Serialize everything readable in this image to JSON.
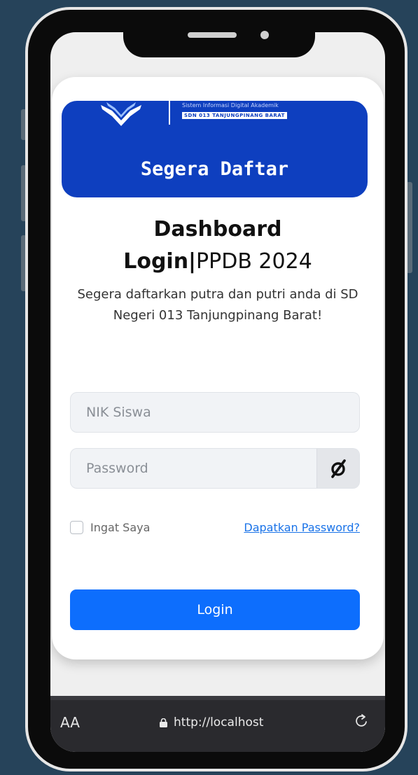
{
  "banner": {
    "brand_subtitle": "Sistem Informasi Digital Akademik",
    "brand_tag": "SDN 013 TANJUNGPINANG BARAT",
    "title": "Segera Daftar"
  },
  "login": {
    "heading_line1": "Dashboard",
    "heading_line2_bold": "Login|",
    "heading_line2_rest": "PPDB 2024",
    "description": "Segera daftarkan putra dan putri anda di SD Negeri 013 Tanjungpinang Barat!",
    "nik_placeholder": "NIK Siswa",
    "password_placeholder": "Password",
    "remember_label": "Ingat Saya",
    "forgot_link": "Dapatkan Password?",
    "login_button": "Login",
    "password_toggle_icon": "eye-slash-icon"
  },
  "browser": {
    "text_size_label": "AA",
    "url": "http://localhost",
    "lock_icon": "lock-icon",
    "reload_icon": "reload-icon"
  },
  "colors": {
    "background": "#26435a",
    "banner": "#0e3fbf",
    "primary_button": "#0d6efd",
    "link": "#1a73e8"
  }
}
